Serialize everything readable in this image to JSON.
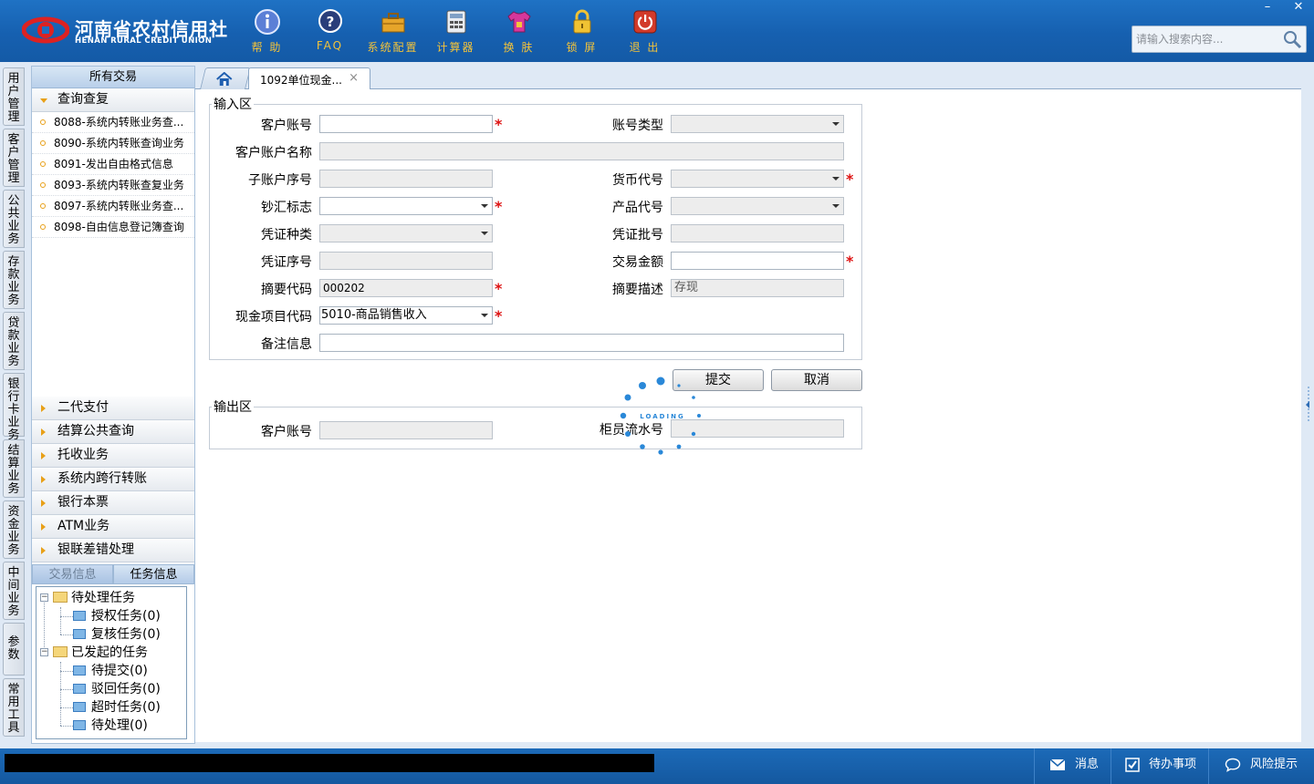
{
  "header": {
    "logo_cn": "河南省农村信用社",
    "logo_en": "HENAN RURAL CREDIT UNION",
    "toolbar": [
      {
        "label": "帮 助",
        "icon": "help-icon"
      },
      {
        "label": "FAQ",
        "icon": "faq-icon"
      },
      {
        "label": "系统配置",
        "icon": "toolbox-icon"
      },
      {
        "label": "计算器",
        "icon": "calculator-icon"
      },
      {
        "label": "换 肤",
        "icon": "shirt-icon"
      },
      {
        "label": "锁 屏",
        "icon": "lock-icon"
      },
      {
        "label": "退 出",
        "icon": "power-icon"
      }
    ],
    "search_placeholder": "请输入搜索内容...",
    "minimize": "–",
    "close": "✕"
  },
  "vertical_tabs": [
    "用户管理",
    "客户管理",
    "公共业务",
    "存款业务",
    "贷款业务",
    "银行卡业务",
    "结算业务",
    "资金业务",
    "中间业务",
    "参数",
    "常用工具"
  ],
  "nav": {
    "title": "所有交易",
    "open_group": "查询查复",
    "items": [
      "8088-系统内转账业务查...",
      "8090-系统内转账查询业务",
      "8091-发出自由格式信息",
      "8093-系统内转账查复业务",
      "8097-系统内转账业务查...",
      "8098-自由信息登记簿查询"
    ],
    "groups": [
      "二代支付",
      "结算公共查询",
      "托收业务",
      "系统内跨行转账",
      "银行本票",
      "ATM业务",
      "银联差错处理"
    ]
  },
  "tasks": {
    "tab_trade": "交易信息",
    "tab_task": "任务信息",
    "pending": "待处理任务",
    "auth": "授权任务(0)",
    "review": "复核任务(0)",
    "initiated": "已发起的任务",
    "to_submit": "待提交(0)",
    "rejected": "驳回任务(0)",
    "timeout": "超时任务(0)",
    "to_handle": "待处理(0)"
  },
  "tabs": {
    "doc_label": "1092单位现金...",
    "close": "×"
  },
  "form": {
    "input_legend": "输入区",
    "output_legend": "输出区",
    "labels": {
      "cust_account": "客户账号",
      "account_type": "账号类型",
      "cust_name": "客户账户名称",
      "sub_account": "子账户序号",
      "currency": "货币代号",
      "cash_flag": "钞汇标志",
      "product": "产品代号",
      "voucher_type": "凭证种类",
      "voucher_batch": "凭证批号",
      "voucher_seq": "凭证序号",
      "amount": "交易金额",
      "summary_code": "摘要代码",
      "summary_desc": "摘要描述",
      "cash_item": "现金项目代码",
      "remark": "备注信息",
      "out_cust_account": "客户账号",
      "teller_serial": "柜员流水号"
    },
    "values": {
      "summary_code": "000202",
      "summary_desc": "存现",
      "cash_item": "5010-商品销售收入"
    },
    "required_mark": "*",
    "submit": "提交",
    "cancel": "取消",
    "loading": "LOADING"
  },
  "status": {
    "message": "消息",
    "todo": "待办事项",
    "risk": "风险提示"
  }
}
